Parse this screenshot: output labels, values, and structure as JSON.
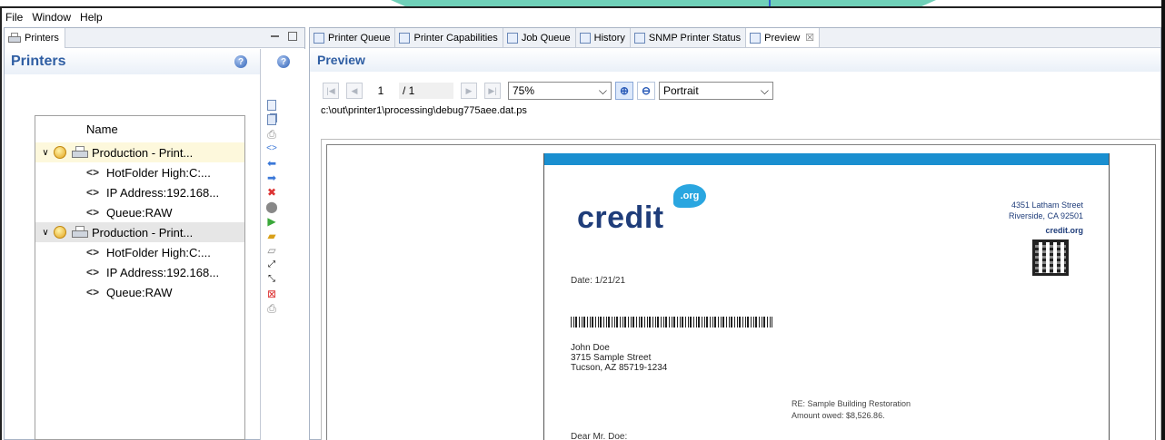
{
  "menu": [
    "File",
    "Window",
    "Help"
  ],
  "left_pane": {
    "tab_label": "Printers",
    "header_title": "Printers",
    "help_glyph": "?",
    "tree": {
      "column_header": "Name",
      "nodes": [
        {
          "label": "Production - Print...",
          "children": [
            "HotFolder High:C:...",
            "IP Address:192.168...",
            "Queue:RAW"
          ]
        },
        {
          "label": "Production - Print...",
          "children": [
            "HotFolder High:C:...",
            "IP Address:192.168...",
            "Queue:RAW"
          ]
        }
      ],
      "code_glyph": "<>",
      "expand_glyph": "∨"
    }
  },
  "toolbar_icons": [
    "document-icon",
    "documents-icon",
    "print-icon",
    "code-icon",
    "arrow-left-icon",
    "arrow-right-icon",
    "delete-icon",
    "stop-icon",
    "play-icon",
    "folder-open-icon",
    "folder-icon",
    "expand-icon",
    "collapse-icon",
    "remove-printer-icon",
    "printer-disabled-icon"
  ],
  "tabs": [
    {
      "label": "Printer Queue",
      "active": false
    },
    {
      "label": "Printer Capabilities",
      "active": false
    },
    {
      "label": "Job Queue",
      "active": false
    },
    {
      "label": "History",
      "active": false
    },
    {
      "label": "SNMP Printer Status",
      "active": false
    },
    {
      "label": "Preview",
      "active": true
    }
  ],
  "tab_close_glyph": "☒",
  "preview": {
    "title": "Preview",
    "page_current": "1",
    "page_total": "/ 1",
    "zoom": "75%",
    "orientation": "Portrait",
    "file_path": "c:\\out\\printer1\\processing\\debug775aee.dat.ps",
    "document": {
      "logo_text": "credit",
      "logo_badge": ".org",
      "address_line1": "4351 Latham Street",
      "address_line2": "Riverside, CA 92501",
      "website": "credit.org",
      "date_line": "Date: 1/21/21",
      "recipient_name": "John Doe",
      "recipient_street": "3715 Sample Street",
      "recipient_city": "Tucson, AZ 85719-1234",
      "re_line": "RE: Sample Building Restoration",
      "amount_line": "Amount owed: $8,526.86.",
      "salutation": "Dear Mr. Doe:"
    }
  },
  "colors": {
    "title_blue": "#2f5ea3",
    "doc_bar_blue": "#1a8fd0",
    "logo_navy": "#1f3d7a",
    "selection_yellow": "#fdf8dc"
  }
}
